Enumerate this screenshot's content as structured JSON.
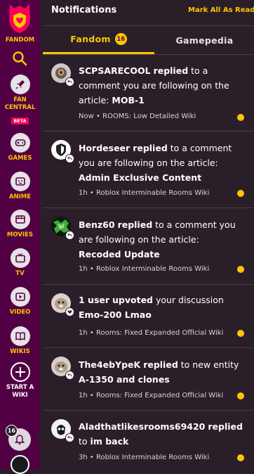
{
  "sidebar": {
    "brand_label": "FANDOM",
    "items": [
      {
        "label": "FAN CENTRAL",
        "label_line1": "FAN",
        "label_line2": "CENTRAL",
        "badge": "BETA"
      },
      {
        "label": "GAMES"
      },
      {
        "label": "ANIME"
      },
      {
        "label": "MOVIES"
      },
      {
        "label": "TV"
      },
      {
        "label": "VIDEO"
      },
      {
        "label": "WIKIS"
      }
    ],
    "start_wiki_line1": "START A",
    "start_wiki_line2": "WIKI",
    "notifications_count": "16"
  },
  "header": {
    "title": "Notifications",
    "mark_all": "Mark All As Read"
  },
  "tabs": {
    "fandom": "Fandom",
    "fandom_count": "16",
    "gamepedia": "Gamepedia"
  },
  "notifications": [
    {
      "user": "SCPSARECOOL",
      "action": "replied",
      "text1": " to a comment you are following on the article: ",
      "target": "MOB-1",
      "text2": "",
      "time": "Now",
      "wiki": "ROOMS: Low Detailed Wiki",
      "unread": true
    },
    {
      "user": "Hordeseer",
      "action": "replied",
      "text1": " to a comment you are following on the article: ",
      "target": "Admin Exclusive Content",
      "text2": "",
      "time": "1h",
      "wiki": "Roblox Interminable Rooms Wiki",
      "unread": true
    },
    {
      "user": "Benz60",
      "action": "replied",
      "text1": " to a comment you are following on the article: ",
      "target": "Recoded Update",
      "text2": "",
      "time": "1h",
      "wiki": "Roblox Interminable Rooms Wiki",
      "unread": true
    },
    {
      "user": "1 user",
      "action": "upvoted",
      "text1": " your discussion ",
      "target": "Emo-200 Lmao",
      "text2": "",
      "time": "1h",
      "wiki": "Rooms: Fixed Expanded Official Wiki",
      "unread": true
    },
    {
      "user": "The4ebYpeK",
      "action": "replied",
      "text1": " to new entity ",
      "target": "A-1350 and clones",
      "text2": "",
      "time": "1h",
      "wiki": "Rooms: Fixed Expanded Official Wiki",
      "unread": true
    },
    {
      "user": "Aladthatlikesrooms69420",
      "action": "replied",
      "text1": " to ",
      "target": "im back",
      "text2": "",
      "time": "3h",
      "wiki": "Roblox Interminable Rooms Wiki",
      "unread": true
    }
  ],
  "colors": {
    "accent": "#ffc500",
    "sidebar": "#520044",
    "panel": "#2a1f29",
    "beta": "#fa005a"
  }
}
